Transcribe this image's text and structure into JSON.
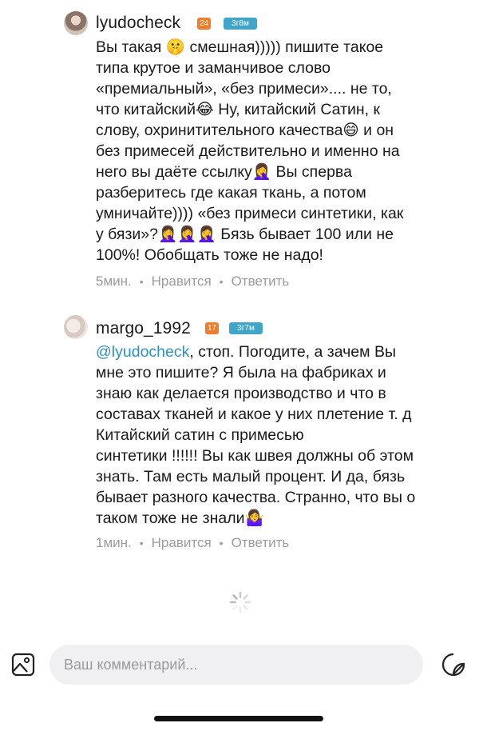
{
  "comments": [
    {
      "username": "lyudocheck",
      "level": "24",
      "age": "3г8м",
      "text": "Вы такая 🤫 смешная))))) пишите такое\nтипа крутое и заманчивое слово\n«премиальный», «без примеси».... не то,\nчто китайский😂 Ну, китайский Сатин, к\nслову, охринитительного качества😄 и он\nбез примесей действительно и именно на\nнего вы даёте ссылку🤦‍♀️ Вы сперва\nразберитесь где какая ткань, а потом\nумничайте)))) «без примеси синтетики, как\nу бязи»?🤦‍♀️🤦‍♀️🤦‍♀️ Бязь бывает 100 или не\n100%! Обобщать тоже не надо!",
      "time": "5мин.",
      "like_label": "Нравится",
      "reply_label": "Ответить"
    },
    {
      "username": "margo_1992",
      "level": "17",
      "age": "3г7м",
      "mention": "@lyudocheck",
      "text": ", стоп. Погодите, а зачем Вы\nмне это пишите? Я была на фабриках и\nзнаю как делается производство и что в\nсоставах тканей и какое у них плетение  т. д\nКитайский сатин с примесью\nсинтетики !!!!!! Вы как швея должны об этом\nзнать. Там есть малый процент. И да, бязь\nбывает разного качества. Странно, что вы о\nтаком тоже не знали🤷‍♀️",
      "time": "1мин.",
      "like_label": "Нравится",
      "reply_label": "Ответить"
    }
  ],
  "separator": "•",
  "composer": {
    "placeholder": "Ваш комментарий...",
    "left_icon": "image-icon",
    "right_icon": "sticker-icon"
  },
  "colors": {
    "level_badge": "#ef7d2a",
    "age_badge": "#3fa6c9",
    "mention": "#2e90c4",
    "meta": "#9b9b9b"
  }
}
